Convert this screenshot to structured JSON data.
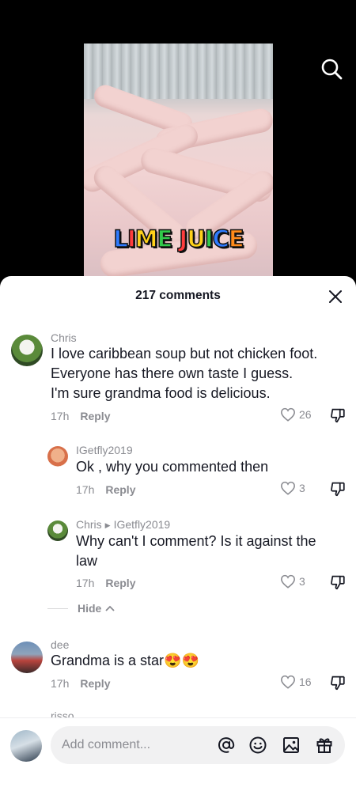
{
  "video": {
    "caption_words": [
      {
        "text": "LIME",
        "colors": [
          "#2e7bff",
          "#ff3d3d",
          "#ffd11a",
          "#31c94a"
        ]
      },
      {
        "text": "JUICE",
        "colors": [
          "#ff3d3d",
          "#ffd11a",
          "#31c94a",
          "#2e7bff",
          "#ff8a1a"
        ]
      }
    ]
  },
  "header": {
    "count_label": "217 comments"
  },
  "comments": [
    {
      "username": "Chris",
      "text_lines": [
        "I love caribbean soup but not chicken foot.",
        "Everyone has there own taste I guess.",
        "I'm sure grandma food is delicious."
      ],
      "time": "17h",
      "reply_label": "Reply",
      "likes": "26"
    },
    {
      "username": "IGetfly2019",
      "text_lines": [
        "Ok , why you commented then"
      ],
      "time": "17h",
      "reply_label": "Reply",
      "likes": "3"
    },
    {
      "username": "Chris",
      "reply_to": "IGetfly2019",
      "text_lines": [
        "Why can't I comment? Is it against the",
        "law"
      ],
      "time": "17h",
      "reply_label": "Reply",
      "likes": "3"
    },
    {
      "username": "dee",
      "text": "Grandma is a star",
      "emoji": "😍😍",
      "time": "17h",
      "reply_label": "Reply",
      "likes": "16"
    }
  ],
  "hide_label": "Hide",
  "partial_username": "risso",
  "input": {
    "placeholder": "Add comment..."
  },
  "icons": {
    "search": "search-icon",
    "close": "close-icon",
    "heart": "heart-outline-icon",
    "dislike": "thumbs-down-icon",
    "mention": "at-sign-icon",
    "emoji": "smiley-icon",
    "image": "image-icon",
    "gift": "gift-icon"
  },
  "colors": {
    "text_primary": "#161823",
    "text_secondary": "#8a8b91",
    "sheet_bg": "#ffffff",
    "input_bg": "#f1f1f2"
  }
}
